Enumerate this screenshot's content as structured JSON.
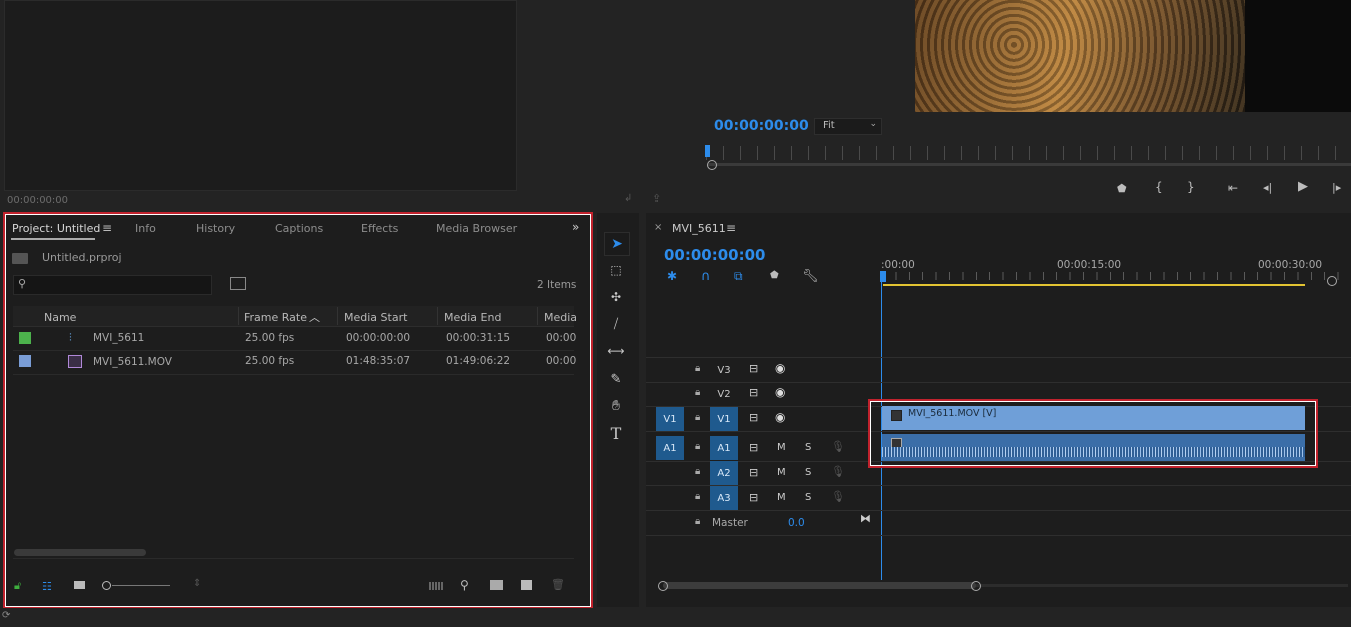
{
  "source_monitor": {
    "timecode": "00:00:00:00"
  },
  "program_monitor": {
    "timecode": "00:00:00:00",
    "zoom_select": "Fit"
  },
  "project_panel": {
    "tabs": [
      "Project: Untitled",
      "Info",
      "History",
      "Captions",
      "Effects",
      "Media Browser"
    ],
    "project_file": "Untitled.prproj",
    "search_placeholder": "",
    "item_count": "2 Items",
    "columns": [
      "Name",
      "Frame Rate",
      "Media Start",
      "Media End",
      "Media"
    ],
    "rows": [
      {
        "color": "#4cb24c",
        "name": "MVI_5611",
        "frame_rate": "25.00 fps",
        "media_start": "00:00:00:00",
        "media_end": "00:00:31:15",
        "media": "00:00"
      },
      {
        "color": "#7a9dd6",
        "name": "MVI_5611.MOV",
        "frame_rate": "25.00 fps",
        "media_start": "01:48:35:07",
        "media_end": "01:49:06:22",
        "media": "00:00"
      }
    ]
  },
  "timeline": {
    "sequence_name": "MVI_5611",
    "timecode": "00:00:00:00",
    "ruler_labels": [
      ":00:00",
      "00:00:15:00",
      "00:00:30:00"
    ],
    "tracks": [
      {
        "src": "",
        "name": "V3"
      },
      {
        "src": "",
        "name": "V2"
      },
      {
        "src": "V1",
        "name": "V1"
      },
      {
        "src": "A1",
        "name": "A1"
      },
      {
        "src": "",
        "name": "A2"
      },
      {
        "src": "",
        "name": "A3"
      }
    ],
    "mute_label": "M",
    "solo_label": "S",
    "master_label": "Master",
    "master_value": "0.0",
    "video_clip_label": "MVI_5611.MOV [V]"
  },
  "colors": {
    "accent": "#2d8ceb",
    "highlight": "#c1222d",
    "clip": "#6f9fd8"
  }
}
